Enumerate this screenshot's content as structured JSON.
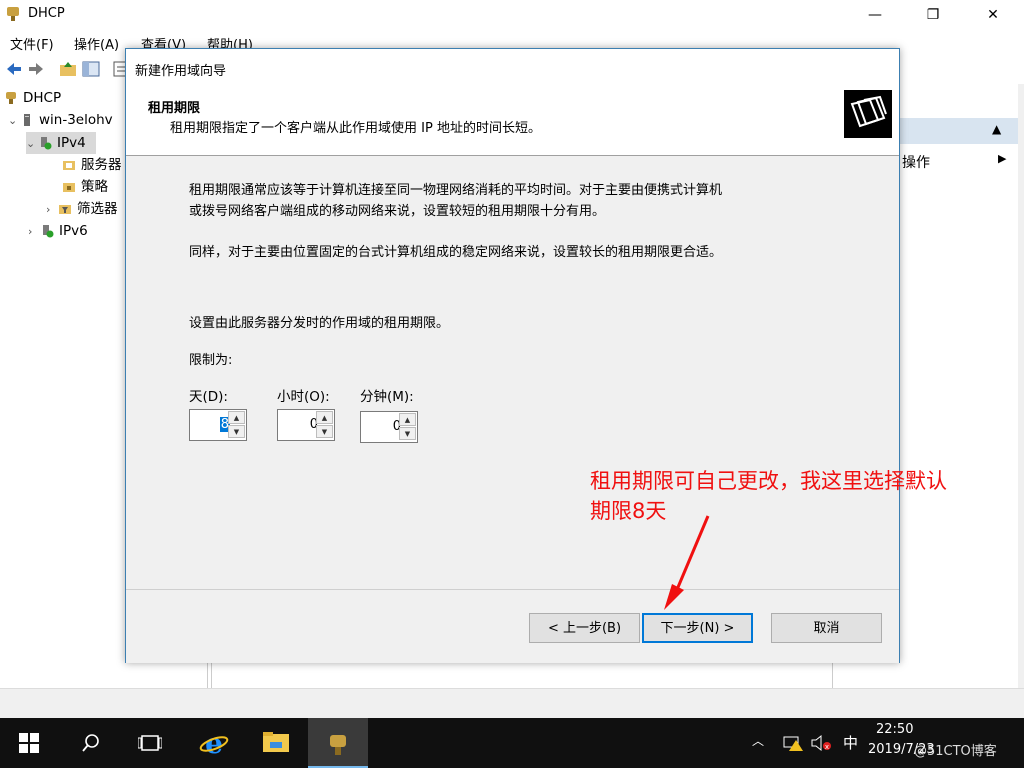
{
  "app": {
    "title": "DHCP"
  },
  "window_controls": {
    "minimize": "—",
    "maximize": "❐",
    "close": "✕"
  },
  "menu": [
    "文件(F)",
    "操作(A)",
    "查看(V)",
    "帮助(H)"
  ],
  "tree": {
    "root": "DHCP",
    "server": "win-3elohv",
    "ipv4": "IPv4",
    "items": [
      "服务器",
      "策略",
      "筛选器"
    ],
    "ipv6": "IPv6"
  },
  "actions": {
    "more": "操作",
    "more_arrow": "▶",
    "up_arrow": "▲"
  },
  "wizard": {
    "title": "新建作用域向导",
    "heading": "租用期限",
    "subheading": "租用期限指定了一个客户端从此作用域使用 IP 地址的时间长短。",
    "para1_line1": "租用期限通常应该等于计算机连接至同一物理网络消耗的平均时间。对于主要由便携式计算机",
    "para1_line2": "或拨号网络客户端组成的移动网络来说，设置较短的租用期限十分有用。",
    "para2": "同样，对于主要由位置固定的台式计算机组成的稳定网络来说，设置较长的租用期限更合适。",
    "para3": "设置由此服务器分发时的作用域的租用期限。",
    "limit_label": "限制为:",
    "fields": {
      "days_label": "天(D):",
      "days_value": "8",
      "hours_label": "小时(O):",
      "hours_value": "0",
      "minutes_label": "分钟(M):",
      "minutes_value": "0"
    },
    "buttons": {
      "back": "< 上一步(B)",
      "next": "下一步(N) >",
      "cancel": "取消"
    }
  },
  "annotation": {
    "line1": "租用期限可自己更改，我这里选择默认",
    "line2": "期限8天",
    "color": "#f01010"
  },
  "taskbar": {
    "ime": "中",
    "time": "22:50",
    "date": "2019/7/23",
    "watermark": "@51CTO博客"
  },
  "colors": {
    "accent": "#0078d7",
    "taskbar": "#101010",
    "dialog_bg": "#f0f0f0"
  }
}
